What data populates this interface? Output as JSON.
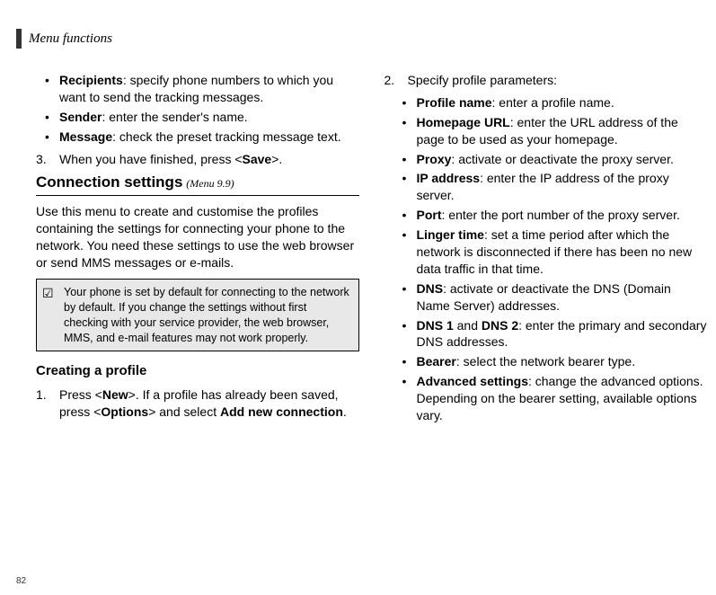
{
  "header": "Menu functions",
  "pageNumber": "82",
  "left": {
    "bullets1": [
      {
        "term": "Recipients",
        "desc": ": specify phone numbers to which you want to send the tracking messages."
      },
      {
        "term": "Sender",
        "desc": ": enter the sender's name."
      },
      {
        "term": "Message",
        "desc": ": check the preset tracking message text."
      }
    ],
    "step3_num": "3.",
    "step3_a": "When you have finished, press <",
    "step3_b": "Save",
    "step3_c": ">.",
    "section_title": "Connection settings",
    "section_menu": "(Menu 9.9)",
    "para1": "Use this menu to create and customise the profiles containing the settings for connecting your phone to the network. You need these settings to use the web browser or send MMS messages or e-mails.",
    "note": "Your phone is set by default for connecting to the network by default. If you change the settings without first checking with your service provider, the web browser, MMS, and e-mail features may not work properly.",
    "subsection": "Creating a profile",
    "step1_num": "1.",
    "step1_a": "Press <",
    "step1_b": "New",
    "step1_c": ">. If a profile has already been saved, press <",
    "step1_d": "Options",
    "step1_e": "> and select ",
    "step1_f": "Add new connection",
    "step1_g": "."
  },
  "right": {
    "step2_num": "2.",
    "step2_text": "Specify profile parameters:",
    "bullets2": [
      {
        "term": "Profile name",
        "desc": ": enter a profile name."
      },
      {
        "term": "Homepage URL",
        "desc": ": enter the URL address of the page to be used as your homepage."
      },
      {
        "term": "Proxy",
        "desc": ": activate or deactivate the proxy server."
      },
      {
        "term": "IP address",
        "desc": ": enter the IP address of the proxy server."
      },
      {
        "term": "Port",
        "desc": ": enter the port number of the proxy server."
      },
      {
        "term": "Linger time",
        "desc": ": set a time period after which the network is disconnected if there has been no new data traffic in that time."
      },
      {
        "term": "DNS",
        "desc": ": activate or deactivate the DNS (Domain Name Server) addresses."
      }
    ],
    "dns_line_a": "DNS 1",
    "dns_line_b": " and ",
    "dns_line_c": "DNS 2",
    "dns_line_d": ": enter the primary and secondary DNS addresses.",
    "bullets3": [
      {
        "term": "Bearer",
        "desc": ": select the network bearer type."
      },
      {
        "term": "Advanced settings",
        "desc": ": change the advanced options. Depending on the bearer setting, available options vary."
      }
    ]
  }
}
